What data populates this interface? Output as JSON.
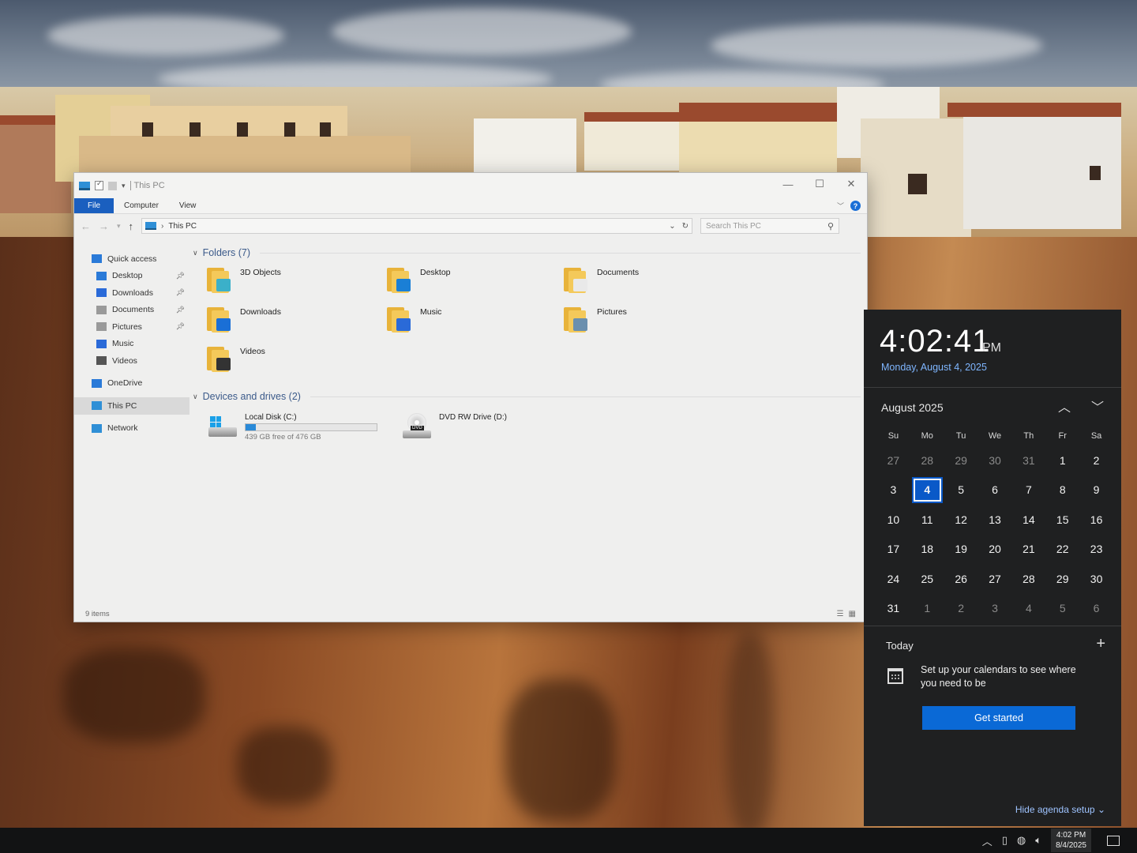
{
  "explorer": {
    "title": "This PC",
    "ribbon_tabs": [
      "File",
      "Computer",
      "View"
    ],
    "address": "This PC",
    "search_placeholder": "Search This PC",
    "nav": [
      {
        "label": "Quick access",
        "icon": "star-icon",
        "color": "#2a7ad8",
        "sub": false,
        "pinned": false
      },
      {
        "label": "Desktop",
        "icon": "desktop-icon",
        "color": "#2a7ad8",
        "sub": true,
        "pinned": true
      },
      {
        "label": "Downloads",
        "icon": "download-icon",
        "color": "#2a6ad8",
        "sub": true,
        "pinned": true
      },
      {
        "label": "Documents",
        "icon": "document-icon",
        "color": "#9a9a9a",
        "sub": true,
        "pinned": true
      },
      {
        "label": "Pictures",
        "icon": "picture-icon",
        "color": "#9a9a9a",
        "sub": true,
        "pinned": true
      },
      {
        "label": "Music",
        "icon": "music-icon",
        "color": "#2a6ad8",
        "sub": true,
        "pinned": false
      },
      {
        "label": "Videos",
        "icon": "video-icon",
        "color": "#555555",
        "sub": true,
        "pinned": false
      },
      {
        "label": "OneDrive",
        "icon": "cloud-icon",
        "color": "#2a7ad8",
        "sub": false,
        "pinned": false
      },
      {
        "label": "This PC",
        "icon": "pc-icon",
        "color": "#2f8fd6",
        "sub": false,
        "pinned": false
      },
      {
        "label": "Network",
        "icon": "network-icon",
        "color": "#2f8fd6",
        "sub": false,
        "pinned": false
      }
    ],
    "folders_header": "Folders (7)",
    "folders": [
      {
        "label": "3D Objects",
        "icon": "3d-objects-folder-icon",
        "badge": "#3bb0c9"
      },
      {
        "label": "Desktop",
        "icon": "desktop-folder-icon",
        "badge": "#1a7fd6"
      },
      {
        "label": "Documents",
        "icon": "documents-folder-icon",
        "badge": "#e9e9e9"
      },
      {
        "label": "Downloads",
        "icon": "downloads-folder-icon",
        "badge": "#1a6fd6"
      },
      {
        "label": "Music",
        "icon": "music-folder-icon",
        "badge": "#2a6ad8"
      },
      {
        "label": "Pictures",
        "icon": "pictures-folder-icon",
        "badge": "#6a8fae"
      },
      {
        "label": "Videos",
        "icon": "videos-folder-icon",
        "badge": "#333333"
      }
    ],
    "drives_header": "Devices and drives (2)",
    "drives": [
      {
        "label": "Local Disk (C:)",
        "free": "439 GB free of 476 GB",
        "used_fraction": 0.078
      },
      {
        "label": "DVD RW Drive (D:)"
      }
    ],
    "status": "9 items"
  },
  "flyout": {
    "time": "4:02:41",
    "ampm": "PM",
    "date": "Monday, August 4, 2025",
    "month": "August 2025",
    "weekdays": [
      "Su",
      "Mo",
      "Tu",
      "We",
      "Th",
      "Fr",
      "Sa"
    ],
    "days": [
      {
        "d": "27",
        "other": true
      },
      {
        "d": "28",
        "other": true
      },
      {
        "d": "29",
        "other": true
      },
      {
        "d": "30",
        "other": true
      },
      {
        "d": "31",
        "other": true
      },
      {
        "d": "1"
      },
      {
        "d": "2"
      },
      {
        "d": "3"
      },
      {
        "d": "4",
        "today": true
      },
      {
        "d": "5"
      },
      {
        "d": "6"
      },
      {
        "d": "7"
      },
      {
        "d": "8"
      },
      {
        "d": "9"
      },
      {
        "d": "10"
      },
      {
        "d": "11"
      },
      {
        "d": "12"
      },
      {
        "d": "13"
      },
      {
        "d": "14"
      },
      {
        "d": "15"
      },
      {
        "d": "16"
      },
      {
        "d": "17"
      },
      {
        "d": "18"
      },
      {
        "d": "19"
      },
      {
        "d": "20"
      },
      {
        "d": "21"
      },
      {
        "d": "22"
      },
      {
        "d": "23"
      },
      {
        "d": "24"
      },
      {
        "d": "25"
      },
      {
        "d": "26"
      },
      {
        "d": "27"
      },
      {
        "d": "28"
      },
      {
        "d": "29"
      },
      {
        "d": "30"
      },
      {
        "d": "31"
      },
      {
        "d": "1",
        "other": true
      },
      {
        "d": "2",
        "other": true
      },
      {
        "d": "3",
        "other": true
      },
      {
        "d": "4",
        "other": true
      },
      {
        "d": "5",
        "other": true
      },
      {
        "d": "6",
        "other": true
      }
    ],
    "agenda_title": "Today",
    "agenda_message": "Set up your calendars to see where you need to be",
    "get_started": "Get started",
    "hide_agenda": "Hide agenda setup"
  },
  "taskbar": {
    "time": "4:02 PM",
    "date": "8/4/2025"
  },
  "colors": {
    "accent": "#0a69d6",
    "file_tab": "#1a5fbf",
    "today_highlight": "#0a59c8"
  }
}
